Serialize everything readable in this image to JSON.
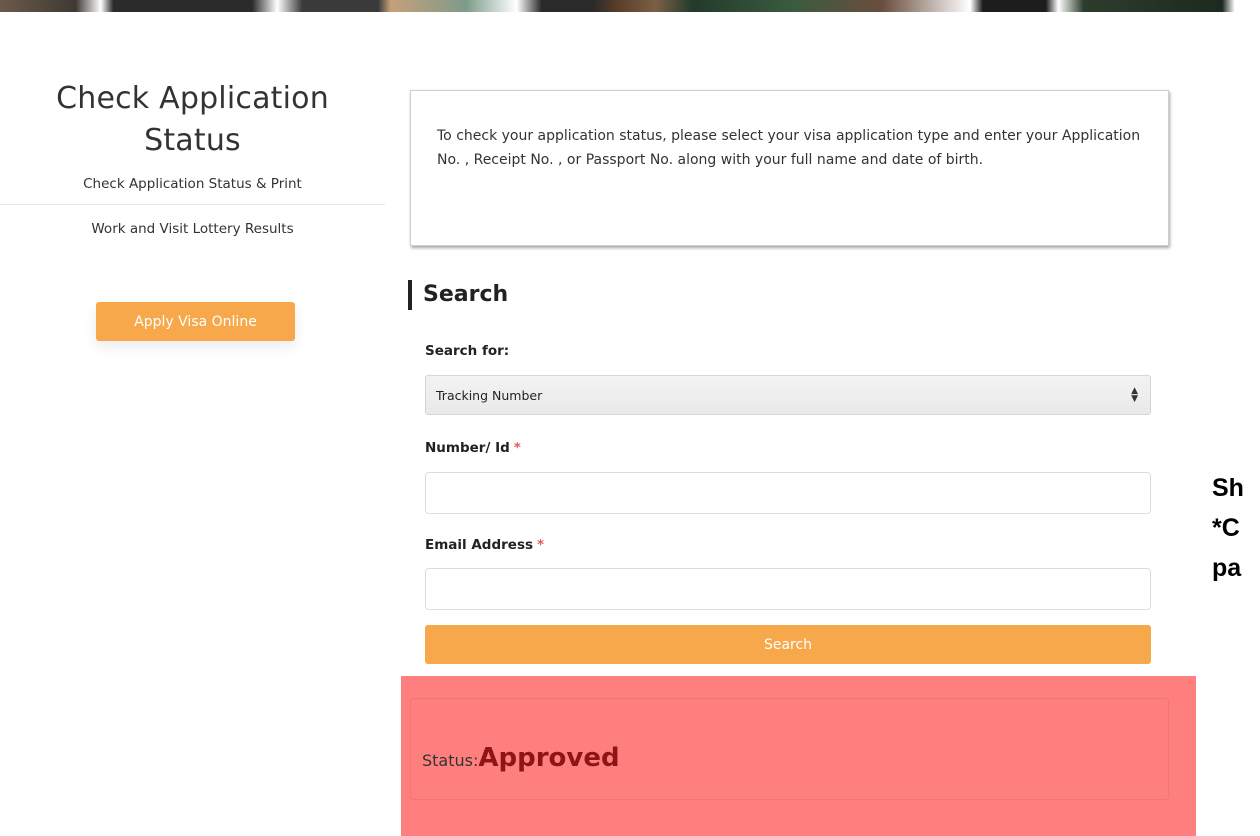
{
  "sidebar": {
    "title_line1": "Check Application",
    "title_line2": "Status",
    "link_status_print": "Check Application Status & Print",
    "link_lottery": "Work and Visit Lottery Results",
    "apply_button": "Apply Visa Online"
  },
  "info": {
    "text": "To check your application status, please select your visa application type and enter your Application No. , Receipt No. , or Passport No. along with your full name and date of birth."
  },
  "search": {
    "heading": "Search",
    "search_for_label": "Search for:",
    "search_for_selected": "Tracking Number",
    "number_label": "Number/ Id",
    "email_label": "Email Address",
    "required_mark": "*",
    "number_value": "",
    "email_value": "",
    "button": "Search"
  },
  "status": {
    "label": "Status:",
    "value": "Approved"
  },
  "side_note": {
    "line1": "Sh",
    "line2": "*C",
    "line3": "pa"
  },
  "colors": {
    "accent_orange": "#f7a84a",
    "status_panel": "#ff7f7f",
    "status_value": "#8e1515",
    "required": "#e05a5a"
  }
}
